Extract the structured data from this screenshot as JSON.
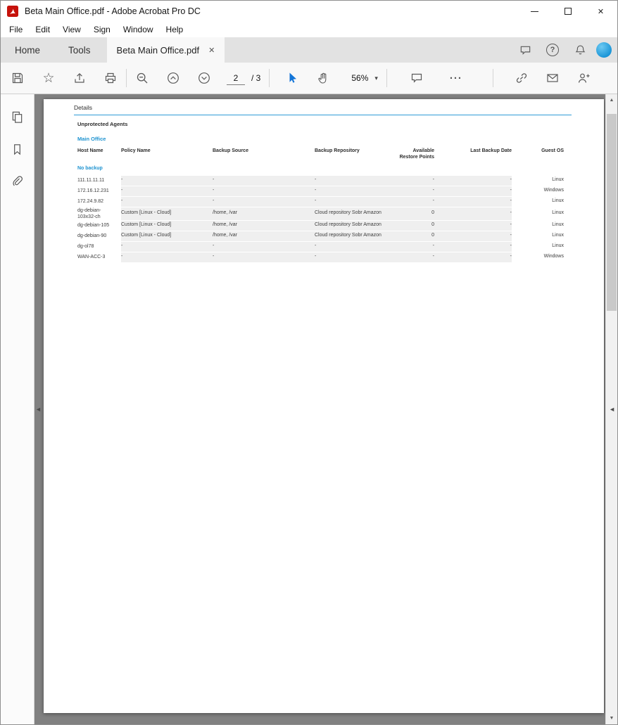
{
  "window": {
    "title": "Beta Main Office.pdf - Adobe Acrobat Pro DC"
  },
  "menu": {
    "items": [
      "File",
      "Edit",
      "View",
      "Sign",
      "Window",
      "Help"
    ]
  },
  "tabbar": {
    "home": "Home",
    "tools": "Tools",
    "document_tab": "Beta Main Office.pdf"
  },
  "toolbar": {
    "page_current": "2",
    "page_suffix": "/ 3",
    "zoom_level": "56%"
  },
  "doc": {
    "section_title": "Details",
    "group_title": "Unprotected Agents",
    "location_title": "Main Office",
    "status_label": "No backup",
    "table": {
      "headers": [
        "Host Name",
        "Policy Name",
        "Backup Source",
        "Backup Repository",
        "Available\nRestore Points",
        "Last Backup Date",
        "Guest OS"
      ],
      "rows": [
        {
          "host": "111.11.11.11",
          "policy": "-",
          "source": "-",
          "repo": "-",
          "points": "-",
          "last": "-",
          "os": "Linux"
        },
        {
          "host": "172.16.12.231",
          "policy": "-",
          "source": "-",
          "repo": "-",
          "points": "-",
          "last": "-",
          "os": "Windows"
        },
        {
          "host": "172.24.9.82",
          "policy": "-",
          "source": "-",
          "repo": "-",
          "points": "-",
          "last": "-",
          "os": "Linux"
        },
        {
          "host": "dg-debian-103x32-ch",
          "policy": "Custom [Linux - Cloud]",
          "source": "/home, /var",
          "repo": "Cloud repository Sobr Amazon",
          "points": "0",
          "last": "-",
          "os": "Linux"
        },
        {
          "host": "dg-debian-105",
          "policy": "Custom [Linux - Cloud]",
          "source": "/home, /var",
          "repo": "Cloud repository Sobr Amazon",
          "points": "0",
          "last": "-",
          "os": "Linux"
        },
        {
          "host": "dg-debian-90",
          "policy": "Custom [Linux - Cloud]",
          "source": "/home, /var",
          "repo": "Cloud repository Sobr Amazon",
          "points": "0",
          "last": "-",
          "os": "Linux"
        },
        {
          "host": "dg-ol78",
          "policy": "-",
          "source": "-",
          "repo": "-",
          "points": "-",
          "last": "-",
          "os": "Linux"
        },
        {
          "host": "WAN-ACC-3",
          "policy": "-",
          "source": "-",
          "repo": "-",
          "points": "-",
          "last": "-",
          "os": "Windows"
        }
      ]
    },
    "colors": {
      "accent_blue": "#1e93d0",
      "rule_blue": "#2e9bd6",
      "row_shade": "#efefef",
      "viewport_gray": "#818181"
    }
  },
  "icons": {
    "star": "☆",
    "help": "?",
    "more": "···",
    "caret_down": "▾",
    "scroll_up": "▲",
    "scroll_down": "▼",
    "collapse_left": "◄",
    "collapse_right": "◄",
    "tab_close": "✕",
    "window_close": "✕"
  }
}
